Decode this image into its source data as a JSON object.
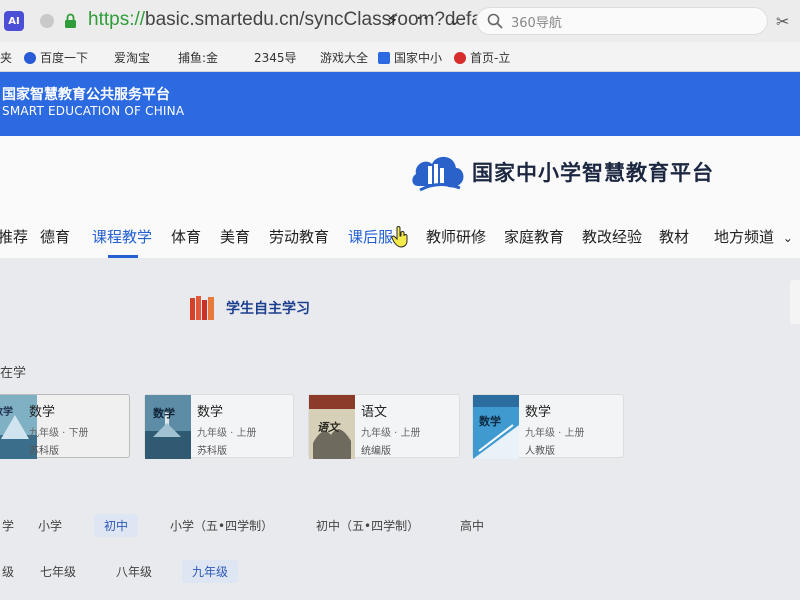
{
  "browser": {
    "ai_badge": "AI",
    "url_scheme": "https://",
    "url_rest": "basic.smartedu.cn/syncClassroom?defau",
    "search_text": "360导航",
    "icons": {
      "lock": "lock-icon",
      "bolt": "bolt-icon",
      "more": "more-dots-icon",
      "chevron": "chevron-down-icon",
      "search": "search-icon",
      "scissors": "scissors-icon"
    }
  },
  "bookmarks": [
    {
      "label": "夹",
      "icon": ""
    },
    {
      "label": "百度一下",
      "icon": "paw-icon"
    },
    {
      "label": "爱淘宝",
      "icon": ""
    },
    {
      "label": "捕鱼:金",
      "icon": ""
    },
    {
      "label": "2345导",
      "icon": ""
    },
    {
      "label": "游戏大全",
      "icon": ""
    },
    {
      "label": "国家中小",
      "icon": "edu-icon"
    },
    {
      "label": "首页-立",
      "icon": "record-icon"
    }
  ],
  "header": {
    "title_cn": "国家智慧教育公共服务平台",
    "title_en": "SMART EDUCATION OF CHINA"
  },
  "platform": {
    "name": "国家中小学智慧教育平台"
  },
  "nav": {
    "items": [
      {
        "label": "推荐"
      },
      {
        "label": "德育"
      },
      {
        "label": "课程教学"
      },
      {
        "label": "体育"
      },
      {
        "label": "美育"
      },
      {
        "label": "劳动教育"
      },
      {
        "label": "课后服"
      },
      {
        "label": "教师研修"
      },
      {
        "label": "家庭教育"
      },
      {
        "label": "教改经验"
      },
      {
        "label": "教材"
      },
      {
        "label": "地方频道"
      }
    ],
    "active_index": 2,
    "dropdown_symbol": "⌄"
  },
  "self_study": {
    "title": "学生自主学习"
  },
  "in_study_label": "在学",
  "recent_books": [
    {
      "subject": "数学",
      "grade": "九年级 · 下册",
      "publisher": "苏科版",
      "cover_label": "数学",
      "cover_color": "#7fb0c4"
    },
    {
      "subject": "数学",
      "grade": "九年级 · 上册",
      "publisher": "苏科版",
      "cover_label": "数学",
      "cover_color": "#5d8da6"
    },
    {
      "subject": "语文",
      "grade": "九年级 · 上册",
      "publisher": "统编版",
      "cover_label": "语文",
      "cover_color": "#c9c2a8"
    },
    {
      "subject": "数学",
      "grade": "九年级 · 上册",
      "publisher": "人教版",
      "cover_label": "数学",
      "cover_color": "#3f9ad0"
    }
  ],
  "stage_filters": {
    "items": [
      "学",
      "小学",
      "初中",
      "小学（五•四学制）",
      "初中（五•四学制）",
      "高中"
    ],
    "active_index": 2
  },
  "grade_filters": {
    "items": [
      "级",
      "七年级",
      "八年级",
      "九年级"
    ],
    "active_index": 3
  },
  "colors": {
    "header_blue": "#2b6ae0",
    "accent_blue": "#2360d2",
    "url_green": "#2f9e3a"
  }
}
